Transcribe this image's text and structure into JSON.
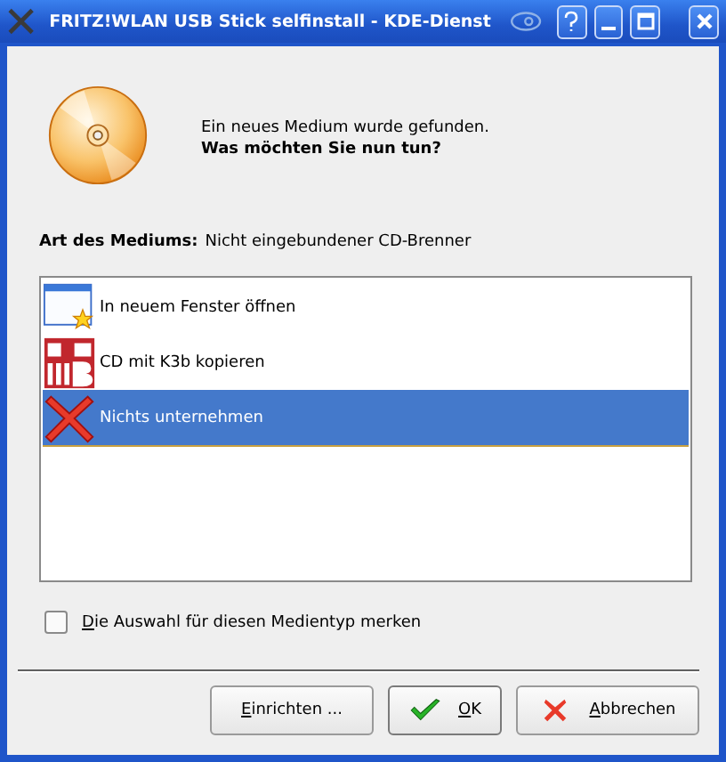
{
  "window": {
    "title": "FRITZ!WLAN USB Stick selfinstall - KDE-Dienst"
  },
  "message": {
    "line1": "Ein neues Medium wurde gefunden.",
    "line2": "Was möchten Sie nun tun?"
  },
  "medium": {
    "label": "Art des Mediums:",
    "value": "Nicht eingebundener CD-Brenner"
  },
  "actions": [
    {
      "kind": "window",
      "label": "In neuem Fenster öffnen",
      "selected": false
    },
    {
      "kind": "k3b",
      "label": "CD mit K3b kopieren",
      "selected": false
    },
    {
      "kind": "cancel",
      "label": "Nichts unternehmen",
      "selected": true
    }
  ],
  "remember": {
    "label": "Die Auswahl für diesen Medientyp merken",
    "checked": false
  },
  "buttons": [
    {
      "kind": "plain",
      "label": "Einrichten ..."
    },
    {
      "kind": "ok",
      "label": "OK"
    },
    {
      "kind": "cancel",
      "label": "Abbrechen"
    }
  ]
}
